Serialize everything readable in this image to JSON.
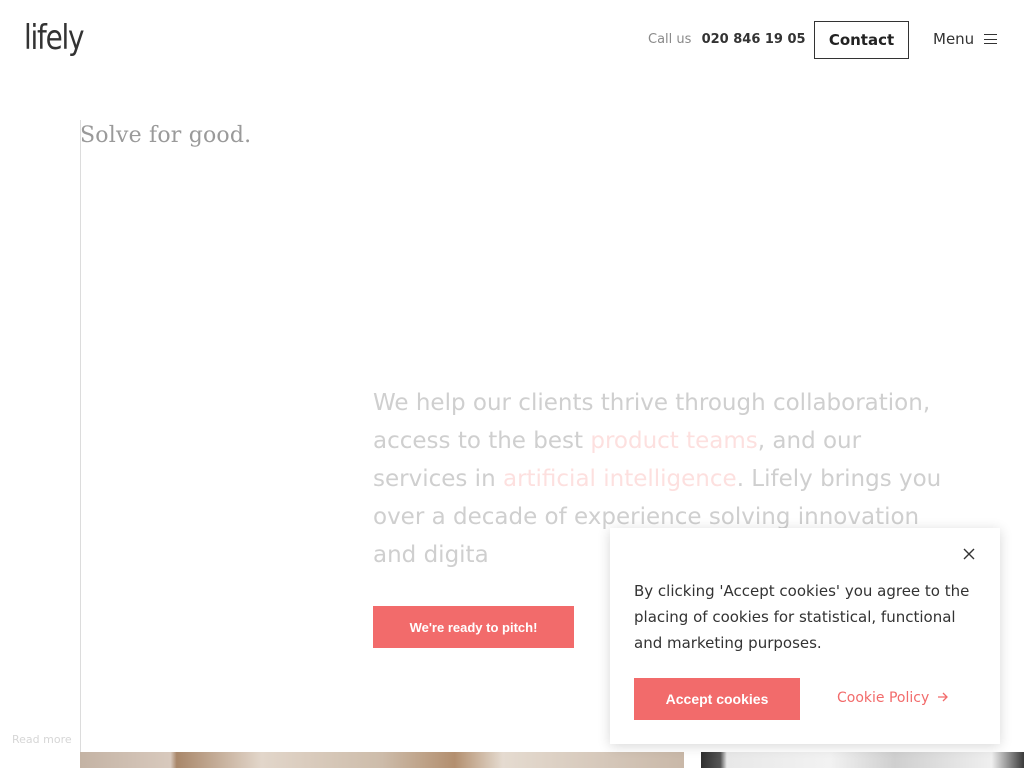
{
  "header": {
    "logo": "lifely",
    "call_label": "Call us",
    "phone": "020 846 19 05",
    "contact_label": "Contact",
    "menu_label": "Menu",
    "menu_icon": "hamburger-icon"
  },
  "hero": {
    "tagline": "Solve for good.",
    "intro_part1": "We help our clients thrive through collaboration, access to the best ",
    "intro_link1": "product teams",
    "intro_part2": ", and our services in ",
    "intro_link2": "artificial intelligence",
    "intro_part3": ". Lifely brings you over a decade of experience solving innovation and digita",
    "pitch_label": "We're ready to pitch!",
    "read_more": "Read more"
  },
  "cookie_banner": {
    "text": "By clicking 'Accept cookies' you agree to the placing of cookies for statistical, functional and marketing purposes.",
    "accept_label": "Accept cookies",
    "policy_label": "Cookie Policy",
    "close_icon": "close-icon",
    "arrow_icon": "arrow-right-icon"
  },
  "colors": {
    "accent": "#f26b6b",
    "text_dark": "#333333",
    "text_faded": "#cfcfcf",
    "link_faded": "#fde0df"
  }
}
